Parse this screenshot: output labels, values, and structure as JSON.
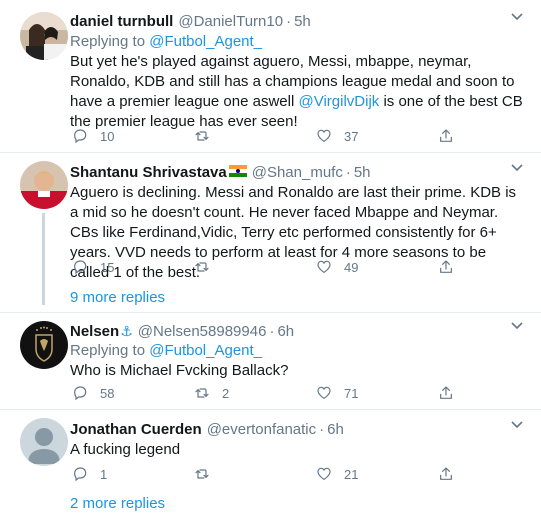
{
  "tweets": [
    {
      "name": "daniel turnbull",
      "handle": "@DanielTurn10",
      "dot": "·",
      "time": "5h",
      "replying_prefix": "Replying to ",
      "replying_to": "@Futbol_Agent_",
      "text_parts": {
        "a": "But yet he's played against aguero, Messi, mbappe, neymar, Ronaldo, KDB and still has a champions league medal and soon to have a premier league one aswell ",
        "mention": "@VirgilvDijk",
        "b": " is one of the best CB the premier league has ever seen!"
      },
      "replies": "10",
      "retweets": "",
      "likes": "37"
    },
    {
      "name": "Shantanu Shrivastava",
      "flag_icon": "india-flag-icon",
      "handle": "@Shan_mufc",
      "dot": "·",
      "time": "5h",
      "text": "Aguero is declining. Messi and Ronaldo are last their prime. KDB is a mid so he doesn't count. He never faced Mbappe and Neymar. CBs like Ferdinand,Vidic, Terry etc performed consistently for 6+ years. VVD needs to perform at least for 4 more seasons to be called 1 of the best.",
      "replies": "15",
      "retweets": "",
      "likes": "49"
    },
    {
      "name": "Nelsen",
      "name_emoji": "⚓",
      "handle": "@Nelsen58989946",
      "dot": "·",
      "time": "6h",
      "replying_prefix": "Replying to ",
      "replying_to": "@Futbol_Agent_",
      "text": "Who is Michael Fvcking Ballack?",
      "replies": "58",
      "retweets": "2",
      "likes": "71"
    },
    {
      "name": "Jonathan Cuerden",
      "handle": "@evertonfanatic",
      "dot": "·",
      "time": "6h",
      "text": "A fucking legend",
      "replies": "1",
      "retweets": "",
      "likes": "21"
    }
  ],
  "more_replies_1": "9 more replies",
  "more_replies_2": "2 more replies",
  "caret": "⌄"
}
